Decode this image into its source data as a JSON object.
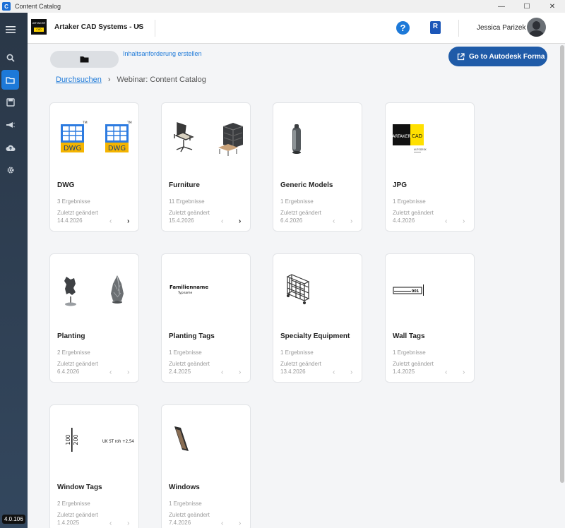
{
  "window": {
    "title": "Content Catalog",
    "controls": [
      "—",
      "☐",
      "✕"
    ]
  },
  "rail": {
    "version": "4.0.106",
    "items": [
      {
        "icon": "menu-icon"
      },
      {
        "icon": "search-icon"
      },
      {
        "icon": "folder-icon",
        "active": true
      },
      {
        "icon": "save-icon"
      },
      {
        "icon": "megaphone-icon"
      },
      {
        "icon": "cloud-upload-icon"
      },
      {
        "icon": "gear-icon"
      }
    ]
  },
  "header": {
    "logo_text": "ARTAKER",
    "logo_sub": "CAD",
    "company": "Artaker CAD Systems - US",
    "help_label": "?",
    "revit_label": "R",
    "user": "Jessica Parizek"
  },
  "toolbar": {
    "request_link": "Inhaltsanforderung erstellen",
    "forma_button": "Go to Autodesk Forma"
  },
  "breadcrumb": {
    "root": "Durchsuchen",
    "separator": "›",
    "current": "Webinar: Content Catalog"
  },
  "cards": [
    {
      "name": "DWG",
      "count": "3 Ergebnisse",
      "changed": "Zuletzt geändert",
      "date": "14.4.2026",
      "next_enabled": true,
      "prev": "‹",
      "next": "›"
    },
    {
      "name": "Furniture",
      "count": "11 Ergebnisse",
      "changed": "Zuletzt geändert",
      "date": "15.4.2026",
      "next_enabled": true,
      "prev": "‹",
      "next": "›"
    },
    {
      "name": "Generic Models",
      "count": "1 Ergebnisse",
      "changed": "Zuletzt geändert",
      "date": "6.4.2026",
      "next_enabled": false,
      "prev": "‹",
      "next": "›"
    },
    {
      "name": "JPG",
      "count": "1 Ergebnisse",
      "changed": "Zuletzt geändert",
      "date": "4.4.2026",
      "next_enabled": false,
      "prev": "‹",
      "next": "›"
    },
    {
      "name": "Planting",
      "count": "2 Ergebnisse",
      "changed": "Zuletzt geändert",
      "date": "6.4.2026",
      "next_enabled": false,
      "prev": "‹",
      "next": "›"
    },
    {
      "name": "Planting Tags",
      "count": "1 Ergebnisse",
      "changed": "Zuletzt geändert",
      "date": "2.4.2025",
      "next_enabled": false,
      "prev": "‹",
      "next": "›"
    },
    {
      "name": "Specialty Equipment",
      "count": "1 Ergebnisse",
      "changed": "Zuletzt geändert",
      "date": "13.4.2026",
      "next_enabled": false,
      "prev": "‹",
      "next": "›"
    },
    {
      "name": "Wall Tags",
      "count": "1 Ergebnisse",
      "changed": "Zuletzt geändert",
      "date": "1.4.2025",
      "next_enabled": false,
      "prev": "‹",
      "next": "›"
    },
    {
      "name": "Window Tags",
      "count": "2 Ergebnisse",
      "changed": "Zuletzt geändert",
      "date": "1.4.2025",
      "next_enabled": false,
      "prev": "‹",
      "next": "›"
    },
    {
      "name": "Windows",
      "count": "1 Ergebnisse",
      "changed": "Zuletzt geändert",
      "date": "7.4.2026",
      "next_enabled": false,
      "prev": "‹",
      "next": "›"
    }
  ],
  "thumbs": {
    "dwg_label": "DWG",
    "dwg_tm": "TM",
    "jpg_left": "ARTAKER",
    "jpg_right": "CAD",
    "jpg_small": "AUTODESK",
    "planting_tag_title": "Familienname",
    "planting_tag_sub": "Typname",
    "wall_tag": "001",
    "window_tag_left": "100",
    "window_tag_left2": "200",
    "window_tag_right": "UK ST roh +2,54"
  },
  "colors": {
    "accent": "#1d79d8",
    "forma_button": "#1f5ba8",
    "rail": "#2a3747"
  }
}
